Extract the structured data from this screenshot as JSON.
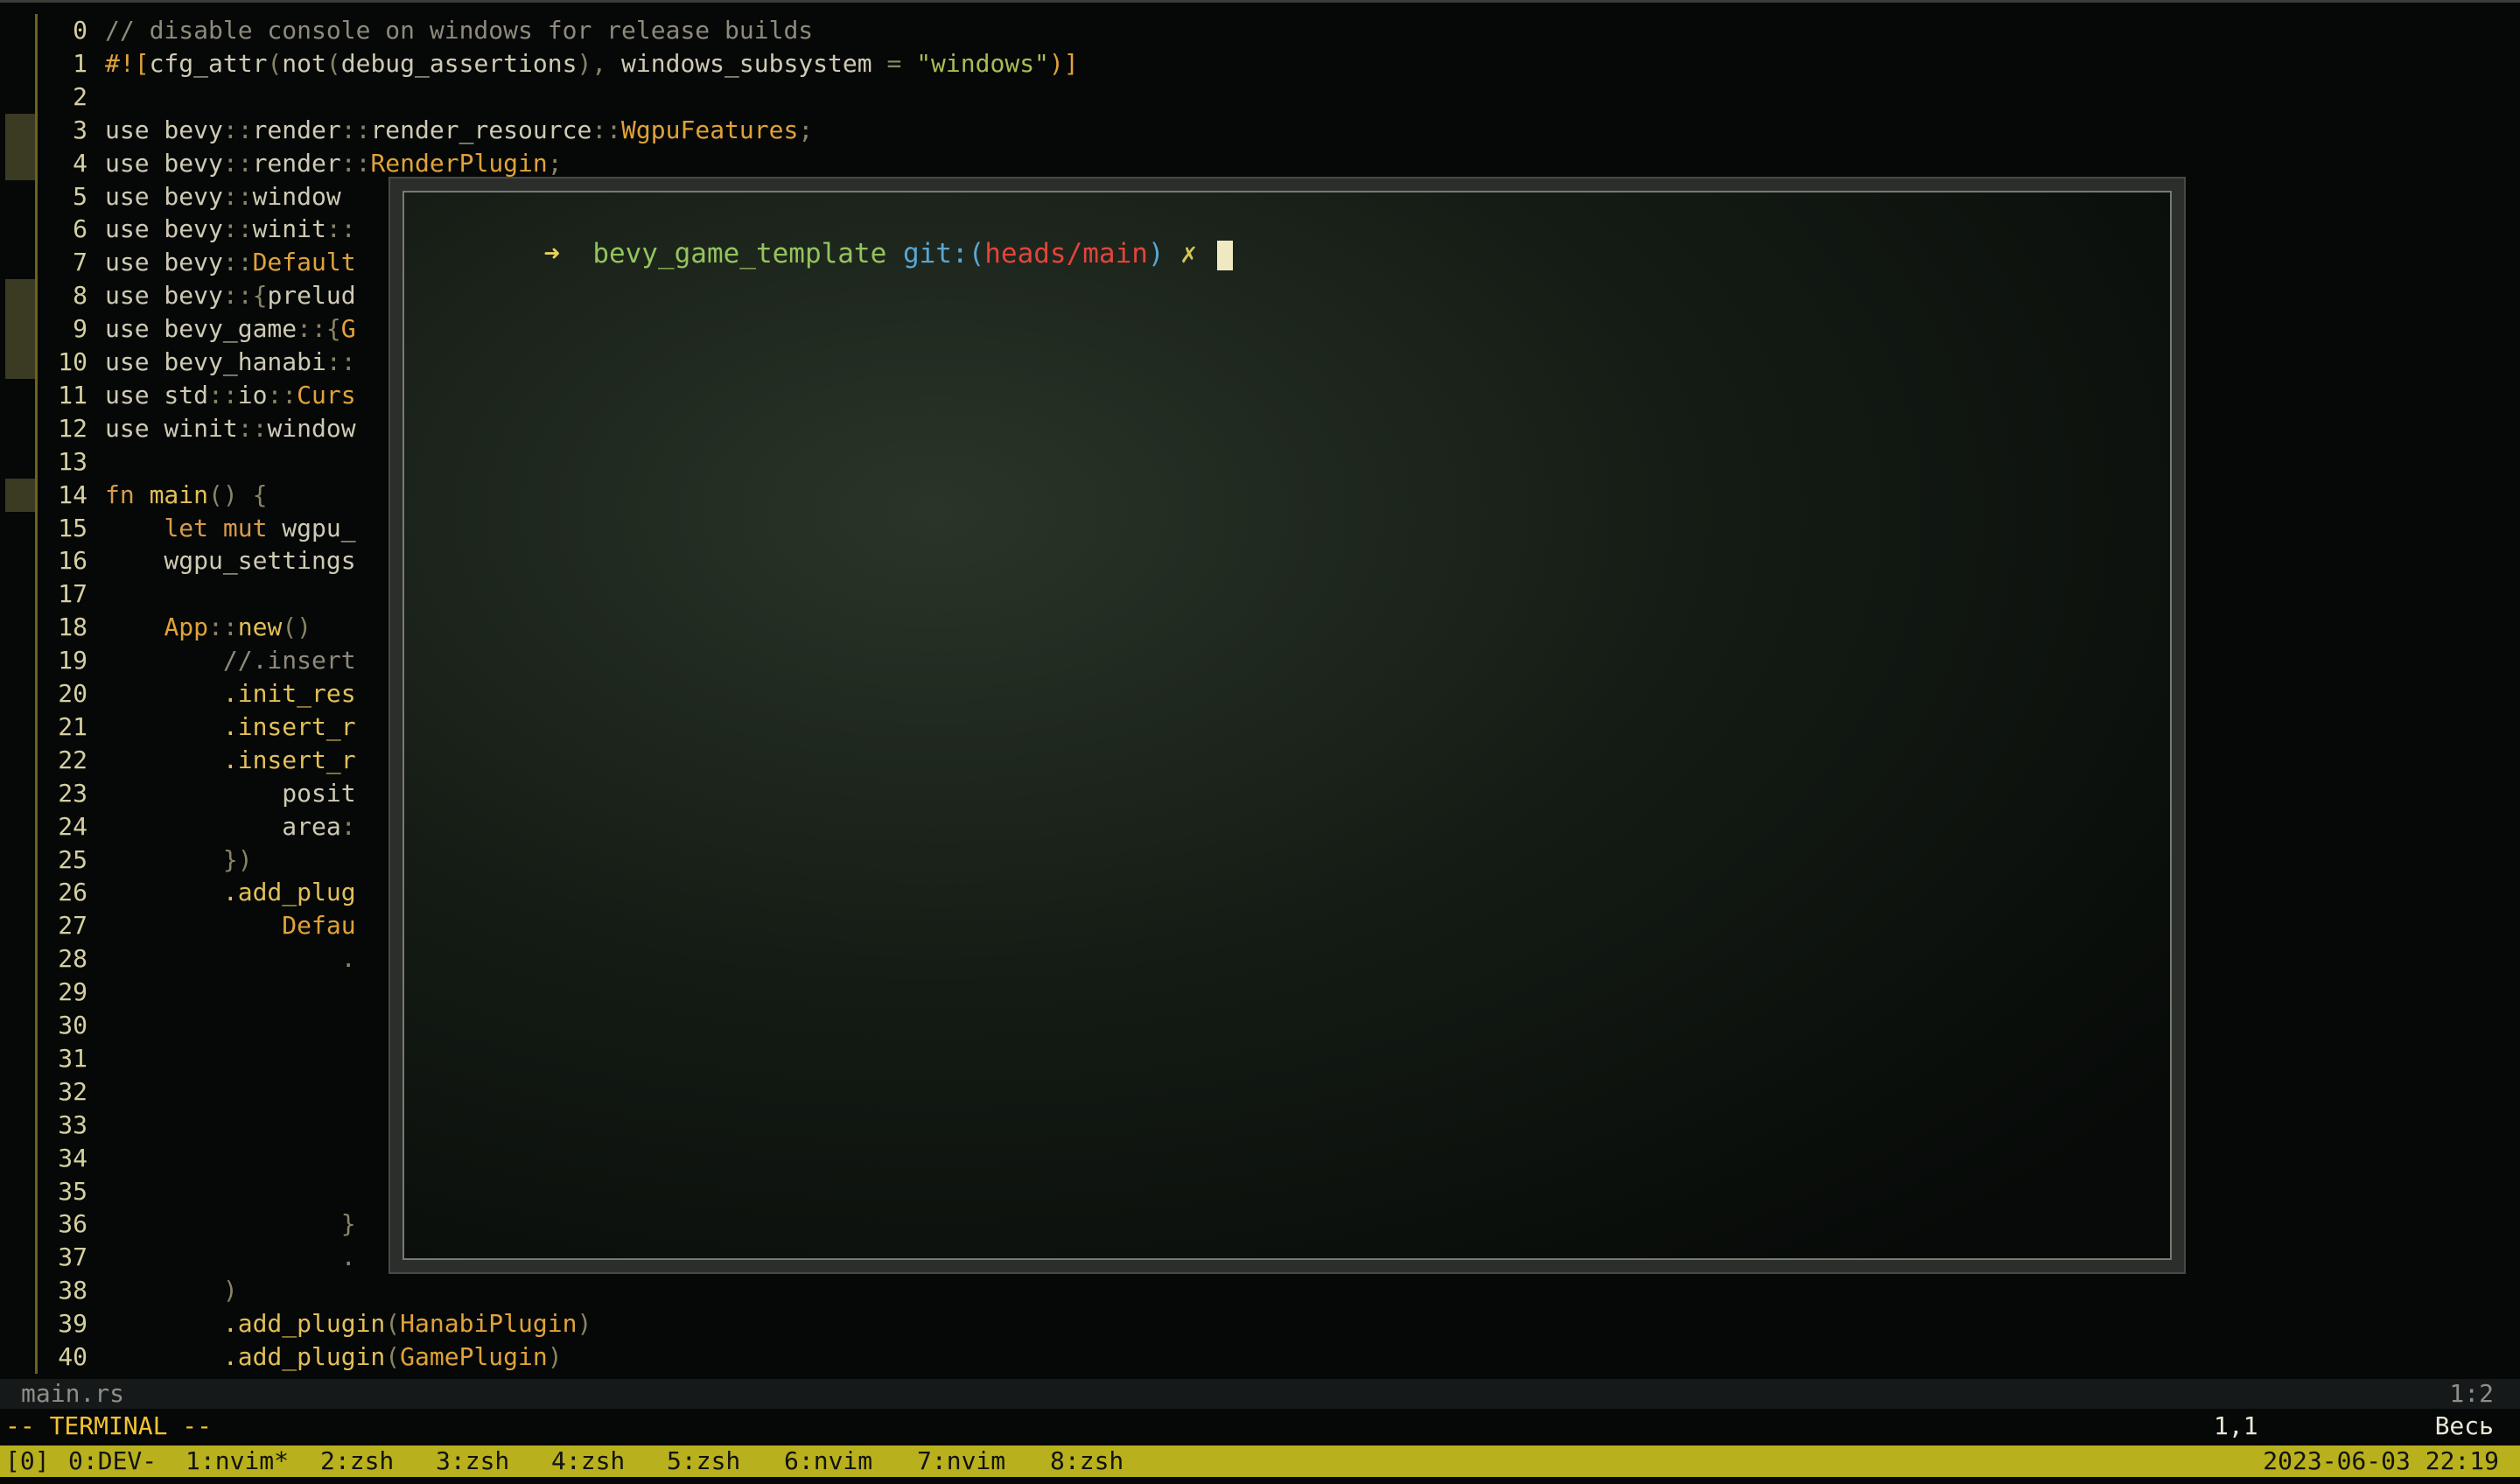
{
  "editor": {
    "lines": [
      {
        "n": "0",
        "parts": [
          [
            "c-cmt",
            "// disable console on windows for release builds"
          ]
        ]
      },
      {
        "n": "1",
        "parts": [
          [
            "c-attr",
            "#!["
          ],
          [
            "",
            "cfg_attr"
          ],
          [
            "c-pun",
            "("
          ],
          [
            "",
            "not"
          ],
          [
            "c-pun",
            "("
          ],
          [
            "",
            "debug_assertions"
          ],
          [
            "c-pun",
            "), "
          ],
          [
            "",
            "windows_subsystem "
          ],
          [
            "c-pun",
            "= "
          ],
          [
            "c-str",
            "\"windows\""
          ],
          [
            "c-attr",
            ")]"
          ]
        ]
      },
      {
        "n": "2",
        "parts": []
      },
      {
        "n": "3",
        "mark": true,
        "parts": [
          [
            "",
            "use bevy"
          ],
          [
            "c-pun",
            "::"
          ],
          [
            "",
            "render"
          ],
          [
            "c-pun",
            "::"
          ],
          [
            "",
            "render_resource"
          ],
          [
            "c-pun",
            "::"
          ],
          [
            "c-type",
            "WgpuFeatures"
          ],
          [
            "c-pun",
            ";"
          ]
        ]
      },
      {
        "n": "4",
        "mark": true,
        "parts": [
          [
            "",
            "use bevy"
          ],
          [
            "c-pun",
            "::"
          ],
          [
            "",
            "render"
          ],
          [
            "c-pun",
            "::"
          ],
          [
            "c-type",
            "RenderPlugin"
          ],
          [
            "c-pun",
            ";"
          ]
        ]
      },
      {
        "n": "5",
        "parts": [
          [
            "",
            "use bevy"
          ],
          [
            "c-pun",
            "::"
          ],
          [
            "",
            "window"
          ]
        ]
      },
      {
        "n": "6",
        "parts": [
          [
            "",
            "use bevy"
          ],
          [
            "c-pun",
            "::"
          ],
          [
            "",
            "winit"
          ],
          [
            "c-pun",
            "::"
          ]
        ]
      },
      {
        "n": "7",
        "parts": [
          [
            "",
            "use bevy"
          ],
          [
            "c-pun",
            "::"
          ],
          [
            "c-type",
            "Default"
          ]
        ]
      },
      {
        "n": "8",
        "mark": true,
        "parts": [
          [
            "",
            "use bevy"
          ],
          [
            "c-pun",
            "::{"
          ],
          [
            "",
            "prelud"
          ]
        ]
      },
      {
        "n": "9",
        "mark": true,
        "parts": [
          [
            "",
            "use bevy_game"
          ],
          [
            "c-pun",
            "::{"
          ],
          [
            "c-type",
            "G"
          ]
        ]
      },
      {
        "n": "10",
        "mark": true,
        "parts": [
          [
            "",
            "use bevy_hanabi"
          ],
          [
            "c-pun",
            "::"
          ]
        ]
      },
      {
        "n": "11",
        "parts": [
          [
            "",
            "use std"
          ],
          [
            "c-pun",
            "::"
          ],
          [
            "",
            "io"
          ],
          [
            "c-pun",
            "::"
          ],
          [
            "c-type",
            "Curs"
          ]
        ]
      },
      {
        "n": "12",
        "parts": [
          [
            "",
            "use winit"
          ],
          [
            "c-pun",
            "::"
          ],
          [
            "",
            "window"
          ]
        ]
      },
      {
        "n": "13",
        "parts": []
      },
      {
        "n": "14",
        "mark": true,
        "parts": [
          [
            "c-kw",
            "fn "
          ],
          [
            "c-fn",
            "main"
          ],
          [
            "c-pun",
            "() {"
          ]
        ]
      },
      {
        "n": "15",
        "parts": [
          [
            "",
            "    "
          ],
          [
            "c-kw",
            "let mut "
          ],
          [
            "",
            "wgpu_"
          ]
        ]
      },
      {
        "n": "16",
        "parts": [
          [
            "",
            "    wgpu_settings"
          ]
        ]
      },
      {
        "n": "17",
        "parts": []
      },
      {
        "n": "18",
        "parts": [
          [
            "",
            "    "
          ],
          [
            "c-type",
            "App"
          ],
          [
            "c-pun",
            "::"
          ],
          [
            "c-fn",
            "new"
          ],
          [
            "c-pun",
            "()"
          ]
        ]
      },
      {
        "n": "19",
        "parts": [
          [
            "",
            "        "
          ],
          [
            "c-cmt",
            "//.insert"
          ]
        ]
      },
      {
        "n": "20",
        "parts": [
          [
            "",
            "        "
          ],
          [
            "c-fn",
            ".init_res"
          ]
        ]
      },
      {
        "n": "21",
        "parts": [
          [
            "",
            "        "
          ],
          [
            "c-fn",
            ".insert_r"
          ]
        ]
      },
      {
        "n": "22",
        "parts": [
          [
            "",
            "        "
          ],
          [
            "c-fn",
            ".insert_r"
          ]
        ]
      },
      {
        "n": "23",
        "parts": [
          [
            "",
            "            posit"
          ]
        ]
      },
      {
        "n": "24",
        "parts": [
          [
            "",
            "            area"
          ],
          [
            "c-pun",
            ":"
          ]
        ]
      },
      {
        "n": "25",
        "parts": [
          [
            "",
            "        "
          ],
          [
            "c-pun",
            "})"
          ]
        ]
      },
      {
        "n": "26",
        "parts": [
          [
            "",
            "        "
          ],
          [
            "c-fn",
            ".add_plug"
          ]
        ]
      },
      {
        "n": "27",
        "parts": [
          [
            "",
            "            "
          ],
          [
            "c-type",
            "Defau"
          ]
        ]
      },
      {
        "n": "28",
        "parts": [
          [
            "",
            "                "
          ],
          [
            "c-pun",
            "."
          ]
        ]
      },
      {
        "n": "29",
        "parts": []
      },
      {
        "n": "30",
        "parts": []
      },
      {
        "n": "31",
        "parts": []
      },
      {
        "n": "32",
        "parts": []
      },
      {
        "n": "33",
        "parts": []
      },
      {
        "n": "34",
        "parts": []
      },
      {
        "n": "35",
        "parts": []
      },
      {
        "n": "36",
        "parts": [
          [
            "",
            "                "
          ],
          [
            "c-pun",
            "}"
          ]
        ]
      },
      {
        "n": "37",
        "parts": [
          [
            "",
            "                "
          ],
          [
            "c-pun",
            "."
          ]
        ]
      },
      {
        "n": "38",
        "parts": [
          [
            "",
            "        "
          ],
          [
            "c-pun",
            ")"
          ]
        ]
      },
      {
        "n": "39",
        "parts": [
          [
            "",
            "        "
          ],
          [
            "c-fn",
            ".add_plugin"
          ],
          [
            "c-pun",
            "("
          ],
          [
            "c-type",
            "HanabiPlugin"
          ],
          [
            "c-pun",
            ")"
          ]
        ]
      },
      {
        "n": "40",
        "parts": [
          [
            "",
            "        "
          ],
          [
            "c-fn",
            ".add_plugin"
          ],
          [
            "c-pun",
            "("
          ],
          [
            "c-type",
            "GamePlugin"
          ],
          [
            "c-pun",
            ")"
          ]
        ]
      }
    ]
  },
  "status": {
    "file_name": "main.rs",
    "position": "1:2"
  },
  "mode": {
    "label": "-- TERMINAL --",
    "cursor_pos": "1,1",
    "scroll": "Весь"
  },
  "tmux": {
    "session": "[0]",
    "windows": [
      "0:DEV-",
      "1:nvim*",
      "2:zsh",
      "3:zsh",
      "4:zsh",
      "5:zsh",
      "6:nvim",
      "7:nvim",
      "8:zsh"
    ],
    "clock": "2023-06-03 22:19"
  },
  "terminal": {
    "arrow": "➜",
    "dir": "bevy_game_template",
    "git_prefix": "git:(",
    "branch": "heads/main",
    "git_suffix": ")",
    "dirty": "✗"
  },
  "colors": {
    "tmux_bar": "#b8b01c",
    "prompt_dir": "#94c35e",
    "branch": "#e3443b"
  }
}
